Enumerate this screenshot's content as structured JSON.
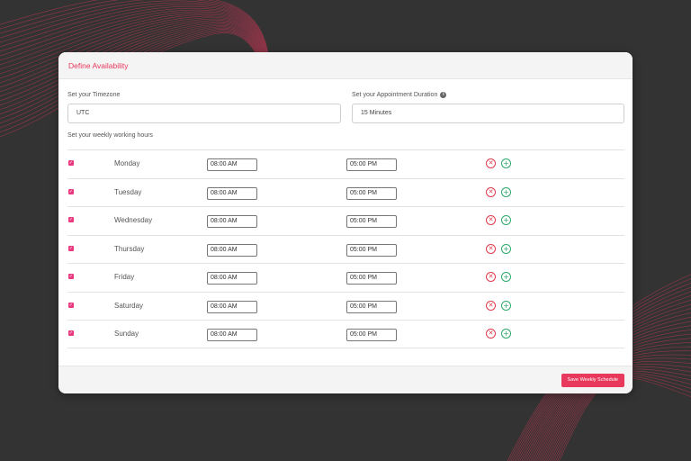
{
  "card": {
    "title": "Define Availability"
  },
  "timezone": {
    "label": "Set your Timezone",
    "value": "UTC"
  },
  "duration": {
    "label": "Set your Appointment Duration",
    "value": "15 Minutes"
  },
  "hours_label": "Set your weekly working hours",
  "schedule": [
    {
      "day": "Monday",
      "start": "08:00 AM",
      "end": "05:00 PM",
      "checked": true
    },
    {
      "day": "Tuesday",
      "start": "08:00 AM",
      "end": "05:00 PM",
      "checked": true
    },
    {
      "day": "Wednesday",
      "start": "08:00 AM",
      "end": "05:00 PM",
      "checked": true
    },
    {
      "day": "Thursday",
      "start": "08:00 AM",
      "end": "05:00 PM",
      "checked": true
    },
    {
      "day": "Friday",
      "start": "08:00 AM",
      "end": "05:00 PM",
      "checked": true
    },
    {
      "day": "Saturday",
      "start": "08:00 AM",
      "end": "05:00 PM",
      "checked": true
    },
    {
      "day": "Sunday",
      "start": "08:00 AM",
      "end": "05:00 PM",
      "checked": true
    }
  ],
  "footer": {
    "save_label": "Save Weekly Schedule"
  },
  "icons": {
    "info": "info-icon",
    "checkbox": "checkbox-checked-icon",
    "remove": "remove-circle-icon",
    "add": "add-circle-icon"
  },
  "colors": {
    "accent": "#e8385c",
    "checkbox": "#e8387f",
    "remove": "#e03b4c",
    "add": "#2ea86b",
    "background": "#333333"
  }
}
